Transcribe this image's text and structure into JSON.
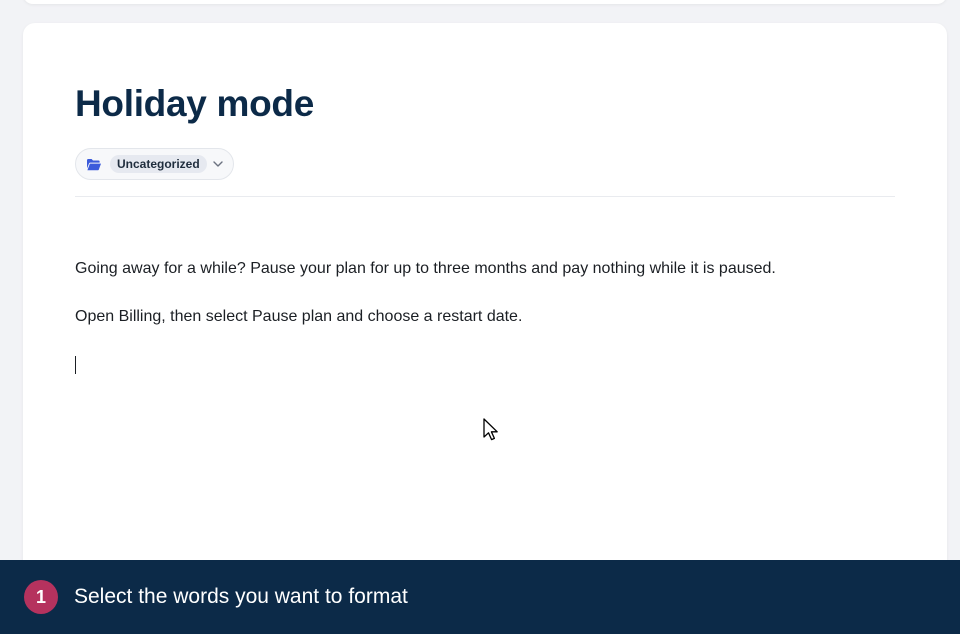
{
  "article": {
    "title": "Holiday mode",
    "category": "Uncategorized",
    "paragraphs": [
      "Going away for a while? Pause your plan for up to three months and pay nothing while it is paused.",
      "Open Billing, then select Pause plan and choose a restart date."
    ]
  },
  "icons": {
    "folder": "folder-open-icon",
    "chevron": "chevron-down-icon",
    "cursor": "mouse-pointer-icon"
  },
  "tip": {
    "step": "1",
    "text": "Select the words you want to format"
  },
  "colors": {
    "title": "#0c2a48",
    "tip_bar": "#0c2a48",
    "step_badge": "#b5325e",
    "folder_icon": "#3b5bdb"
  }
}
